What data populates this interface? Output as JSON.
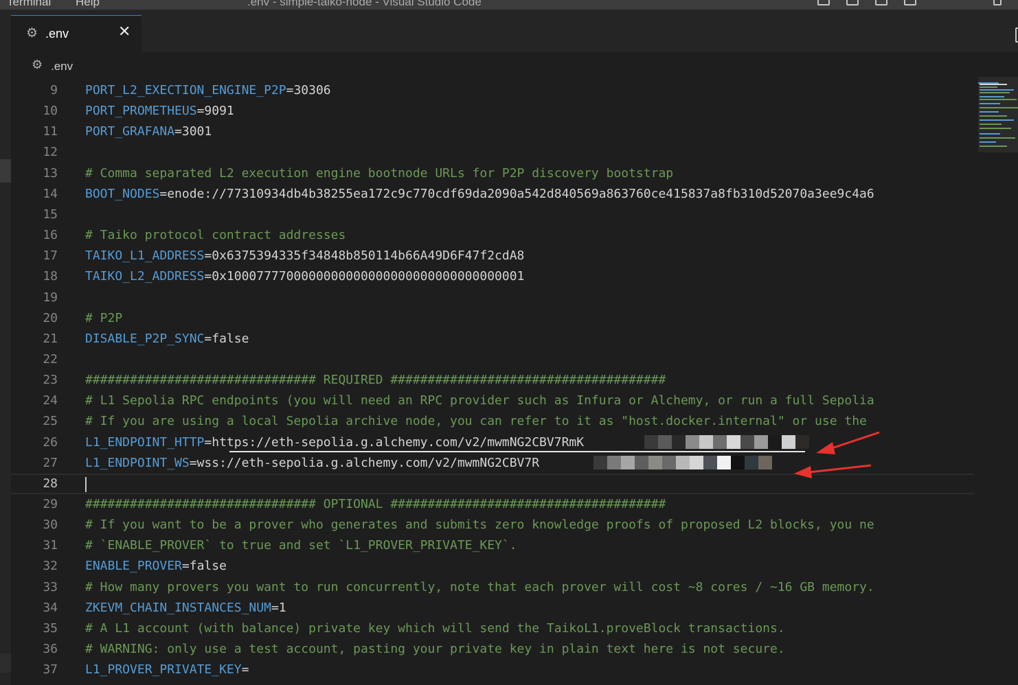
{
  "titlebar": {
    "menu": [
      "Terminal",
      "Help"
    ],
    "title": ".env - simple-taiko-node - Visual Studio Code"
  },
  "tab": {
    "name": ".env",
    "close": "✕",
    "icon": "gear-icon"
  },
  "breadcrumb": {
    "file": ".env",
    "icon": "gear-icon"
  },
  "editor": {
    "current_line": "28",
    "lines": [
      {
        "n": "9",
        "k": "PORT_L2_EXECTION_ENGINE_P2P",
        "v": "=30306"
      },
      {
        "n": "10",
        "k": "PORT_PROMETHEUS",
        "v": "=9091"
      },
      {
        "n": "11",
        "k": "PORT_GRAFANA",
        "v": "=3001"
      },
      {
        "n": "12"
      },
      {
        "n": "13",
        "c": "# Comma separated L2 execution engine bootnode URLs for P2P discovery bootstrap"
      },
      {
        "n": "14",
        "k": "BOOT_NODES",
        "v": "=enode://77310934db4b38255ea172c9c770cdf69da2090a542d840569a863760ce415837a8fb310d52070a3ee9c4a6"
      },
      {
        "n": "15"
      },
      {
        "n": "16",
        "c": "# Taiko protocol contract addresses"
      },
      {
        "n": "17",
        "k": "TAIKO_L1_ADDRESS",
        "v": "=0x6375394335f34848b850114b66A49D6F47f2cdA8"
      },
      {
        "n": "18",
        "k": "TAIKO_L2_ADDRESS",
        "v": "=0x1000777700000000000000000000000000000001"
      },
      {
        "n": "19"
      },
      {
        "n": "20",
        "c": "# P2P"
      },
      {
        "n": "21",
        "k": "DISABLE_P2P_SYNC",
        "v": "=false"
      },
      {
        "n": "22"
      },
      {
        "n": "23",
        "c": "############################### REQUIRED #####################################"
      },
      {
        "n": "24",
        "c": "# L1 Sepolia RPC endpoints (you will need an RPC provider such as Infura or Alchemy, or run a full Sepolia"
      },
      {
        "n": "25",
        "c": "# If you are using a local Sepolia archive node, you can refer to it as \"host.docker.internal\" or use the"
      },
      {
        "n": "26",
        "k": "L1_ENDPOINT_HTTP",
        "v": "=https://eth-sepolia.g.alchemy.com/v2/mwmNG2CBV7RmK"
      },
      {
        "n": "27",
        "k": "L1_ENDPOINT_WS",
        "v": "=wss://eth-sepolia.g.alchemy.com/v2/mwmNG2CBV7R"
      },
      {
        "n": "28"
      },
      {
        "n": "29",
        "c": "############################### OPTIONAL #####################################"
      },
      {
        "n": "30",
        "c": "# If you want to be a prover who generates and submits zero knowledge proofs of proposed L2 blocks, you ne"
      },
      {
        "n": "31",
        "c": "# `ENABLE_PROVER` to true and set `L1_PROVER_PRIVATE_KEY`."
      },
      {
        "n": "32",
        "k": "ENABLE_PROVER",
        "v": "=false"
      },
      {
        "n": "33",
        "c": "# How many provers you want to run concurrently, note that each prover will cost ~8 cores / ~16 GB memory."
      },
      {
        "n": "34",
        "k": "ZKEVM_CHAIN_INSTANCES_NUM",
        "v": "=1"
      },
      {
        "n": "35",
        "c": "# A L1 account (with balance) private key which will send the TaikoL1.proveBlock transactions."
      },
      {
        "n": "36",
        "c": "# WARNING: only use a test account, pasting your private key in plain text here is not secure."
      },
      {
        "n": "37",
        "k": "L1_PROVER_PRIVATE_KEY",
        "v": "="
      }
    ]
  },
  "colors": {
    "key": "#569cd6",
    "comment": "#6a9955",
    "value": "#d4d4d4",
    "arrow": "#e8322b"
  }
}
